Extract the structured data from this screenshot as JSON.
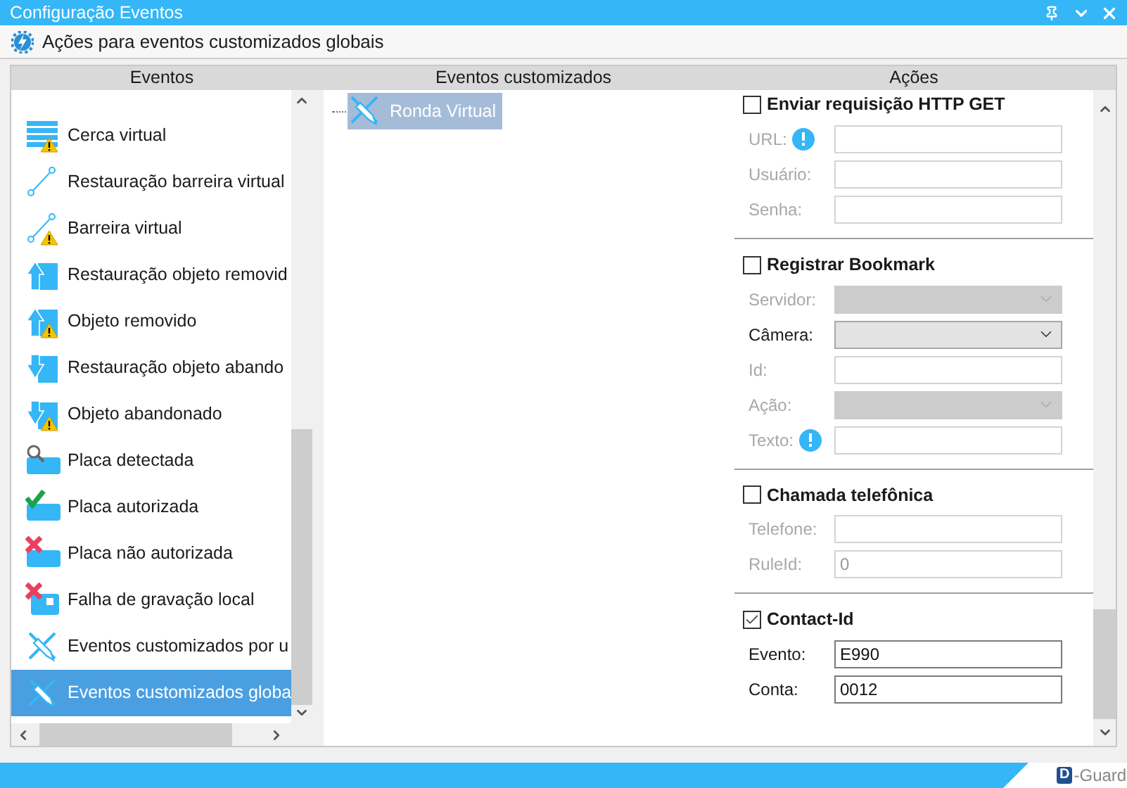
{
  "window": {
    "title": "Configuração Eventos"
  },
  "toolbar": {
    "title": "Ações para eventos customizados globais"
  },
  "columns": [
    "Eventos",
    "Eventos customizados",
    "Ações"
  ],
  "events": [
    {
      "label": "Cerca virtual",
      "kind": "fence",
      "warning": true,
      "selected": false
    },
    {
      "label": "Restauração barreira virtual",
      "kind": "line",
      "warning": false,
      "selected": false
    },
    {
      "label": "Barreira virtual",
      "kind": "line",
      "warning": true,
      "selected": false
    },
    {
      "label": "Restauração objeto removid",
      "kind": "removed",
      "warning": false,
      "selected": false
    },
    {
      "label": "Objeto removido",
      "kind": "removed",
      "warning": true,
      "selected": false
    },
    {
      "label": "Restauração objeto abando",
      "kind": "abandoned",
      "warning": false,
      "selected": false
    },
    {
      "label": "Objeto abandonado",
      "kind": "abandoned",
      "warning": true,
      "selected": false
    },
    {
      "label": "Placa detectada",
      "kind": "plate-search",
      "warning": false,
      "selected": false
    },
    {
      "label": "Placa autorizada",
      "kind": "plate-check",
      "warning": false,
      "selected": false
    },
    {
      "label": "Placa não autorizada",
      "kind": "plate-x",
      "warning": false,
      "selected": false
    },
    {
      "label": "Falha de gravação local",
      "kind": "disk-x",
      "warning": false,
      "selected": false
    },
    {
      "label": "Eventos customizados por u",
      "kind": "custom",
      "warning": false,
      "selected": false
    },
    {
      "label": "Eventos customizados globa",
      "kind": "custom",
      "warning": false,
      "selected": true
    }
  ],
  "custom_events": [
    {
      "label": "Ronda Virtual",
      "selected": true
    }
  ],
  "actions": [
    {
      "title": "Enviar requisição HTTP GET",
      "checked": false,
      "fields": [
        {
          "label": "URL:",
          "kind": "text",
          "disabled": true,
          "info": true
        },
        {
          "label": "Usuário:",
          "kind": "text",
          "disabled": true,
          "info": false
        },
        {
          "label": "Senha:",
          "kind": "text",
          "disabled": true,
          "info": false
        }
      ]
    },
    {
      "title": "Registrar Bookmark",
      "checked": false,
      "fields": [
        {
          "label": "Servidor:",
          "kind": "select",
          "disabled": true,
          "info": false
        },
        {
          "label": "Câmera:",
          "kind": "select",
          "disabled": false,
          "info": false
        },
        {
          "label": "Id:",
          "kind": "text",
          "disabled": true,
          "info": false
        },
        {
          "label": "Ação:",
          "kind": "select",
          "disabled": true,
          "info": false
        },
        {
          "label": "Texto:",
          "kind": "text",
          "disabled": true,
          "info": true
        }
      ]
    },
    {
      "title": "Chamada telefônica",
      "checked": false,
      "fields": [
        {
          "label": "Telefone:",
          "kind": "text",
          "disabled": true,
          "info": false
        },
        {
          "label": "RuleId:",
          "kind": "text",
          "disabled": true,
          "info": false,
          "value": "0"
        }
      ]
    },
    {
      "title": "Contact-Id",
      "checked": true,
      "fields": [
        {
          "label": "Evento:",
          "kind": "text",
          "disabled": false,
          "info": false,
          "value": "E990"
        },
        {
          "label": "Conta:",
          "kind": "text",
          "disabled": false,
          "info": false,
          "value": "0012"
        }
      ]
    }
  ],
  "footer": {
    "logo_mark": "D",
    "logo_text": "-Guard"
  }
}
